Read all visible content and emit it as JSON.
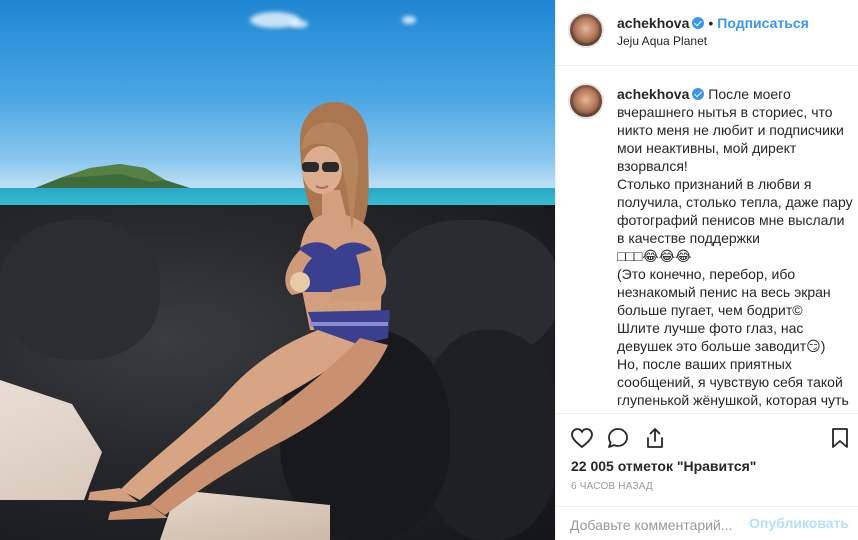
{
  "header": {
    "username": "achekhova",
    "separator": "•",
    "follow_label": "Подписаться",
    "location": "Jeju Aqua Planet"
  },
  "caption": {
    "username": "achekhova",
    "text": "После моего вчерашнего нытья в сториес, что никто меня не любит и подписчики мои неактивны, мой директ взорвался!\nСтолько признаний в любви я получила, столько тепла, даже пару фотографий пенисов мне выслали в качестве поддержки\n□□□😂😂😂\n(Это конечно, перебор, ибо незнакомый пенис на весь экран больше пугает, чем бодрит©\nШлите лучше фото глаз, нас девушек это больше заводит😏)\nНо, после ваших приятных сообщений, я чувствую себя такой глупенькой жёнушкой, которая чуть что пускает сопли своему мужу: «Ты меня не"
  },
  "actions": {
    "icons": [
      "heart-icon",
      "comment-icon",
      "share-icon",
      "bookmark-icon"
    ],
    "likes_text": "22 005 отметок \"Нравится\"",
    "time_ago": "6 часов назад"
  },
  "comment": {
    "placeholder": "Добавьте комментарий...",
    "post_label": "Опубликовать"
  },
  "colors": {
    "accent": "#3897f0",
    "post_disabled": "#b2dffc",
    "muted": "#999999"
  }
}
